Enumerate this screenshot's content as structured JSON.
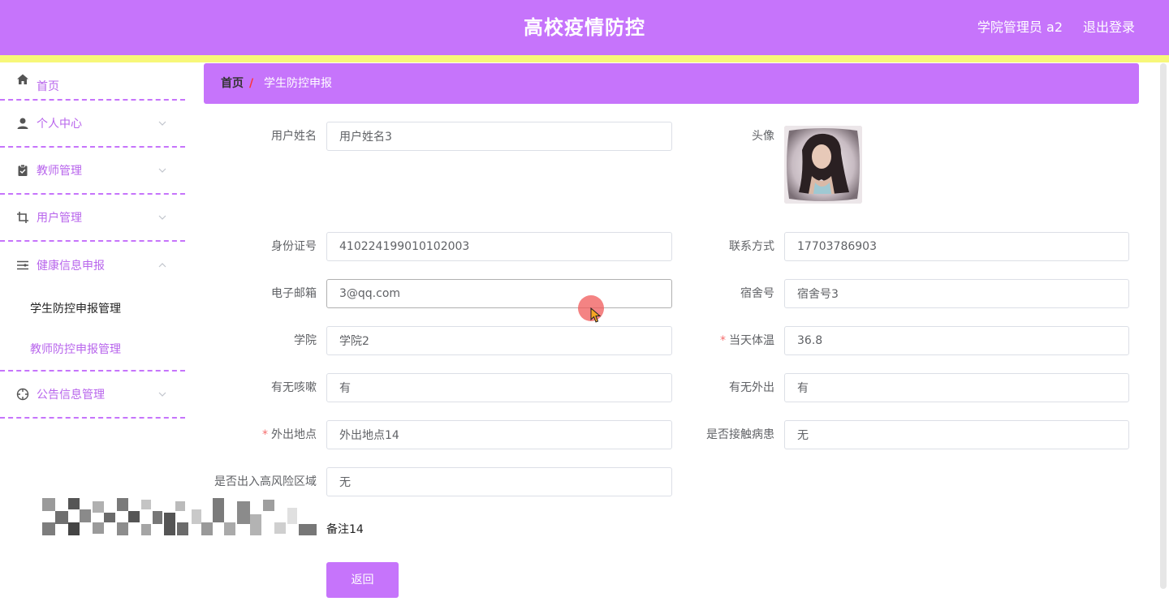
{
  "header": {
    "title": "高校疫情防控",
    "user": "学院管理员 a2",
    "logout": "退出登录"
  },
  "sidebar": {
    "items": [
      {
        "label": "首页",
        "icon": "home-icon"
      },
      {
        "label": "个人中心",
        "icon": "user-icon"
      },
      {
        "label": "教师管理",
        "icon": "clipboard-icon"
      },
      {
        "label": "用户管理",
        "icon": "crop-icon"
      },
      {
        "label": "健康信息申报",
        "icon": "list-icon"
      },
      {
        "label": "公告信息管理",
        "icon": "target-icon"
      }
    ],
    "submenu": [
      "学生防控申报管理",
      "教师防控申报管理"
    ]
  },
  "breadcrumb": {
    "home": "首页",
    "separator": "/",
    "current": "学生防控申报"
  },
  "form": {
    "username": {
      "label": "用户姓名",
      "value": "用户姓名3"
    },
    "avatar": {
      "label": "头像"
    },
    "id_number": {
      "label": "身份证号",
      "value": "410224199010102003"
    },
    "phone": {
      "label": "联系方式",
      "value": "17703786903"
    },
    "email": {
      "label": "电子邮箱",
      "value": "3@qq.com"
    },
    "dorm": {
      "label": "宿舍号",
      "value": "宿舍号3"
    },
    "college": {
      "label": "学院",
      "value": "学院2"
    },
    "temperature": {
      "label": "当天体温",
      "value": "36.8",
      "required": "*"
    },
    "cough": {
      "label": "有无咳嗽",
      "value": "有"
    },
    "went_out": {
      "label": "有无外出",
      "value": "有"
    },
    "out_place": {
      "label": "外出地点",
      "value": "外出地点14",
      "required": "*"
    },
    "contact_patient": {
      "label": "是否接触病患",
      "value": "无"
    },
    "high_risk": {
      "label": "是否出入高风险区域",
      "value": "无"
    },
    "remark": {
      "value": "备注14"
    }
  },
  "buttons": {
    "back": "返回"
  },
  "colors": {
    "primary": "#c674fb",
    "accent_yellow": "#f7f779",
    "menu_text": "#b865ec",
    "required": "#f56c6c"
  }
}
